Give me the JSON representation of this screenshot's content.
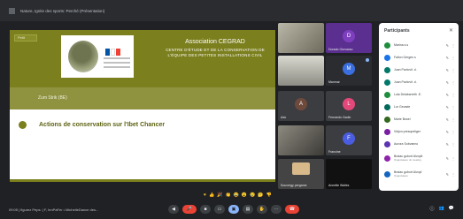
{
  "window": {
    "title": "Nature, Ignite des sports: Perché (Présentation)"
  },
  "slide": {
    "small_label": "Petit",
    "association_title": "Association CEGRAD",
    "association_subtitle": "CENTRE D'ÉTUDE ET DE LA CONSERVATION DE L'ÉQUIPE DES PETITES INSTALLATIONS CIVIL",
    "band_label": "Zum Strik (BE)",
    "action_text": "Actions de conservation sur l'Ibet Chancer"
  },
  "tiles": [
    {
      "name": "",
      "initial": "",
      "color": "#8a8a7a"
    },
    {
      "name": "Dorado Gorvasso",
      "initial": "D",
      "color": "#5b2f8f"
    },
    {
      "name": "",
      "initial": "",
      "color": "#9b9b92"
    },
    {
      "name": "Manmar",
      "initial": "M",
      "color": "#3b6fe0"
    },
    {
      "name": "Ado",
      "initial": "A",
      "color": "#6e4a3c"
    },
    {
      "name": "Fernando Gadin",
      "initial": "L",
      "color": "#e2487a"
    },
    {
      "name": "",
      "initial": "",
      "color": "#5a5a55"
    },
    {
      "name": "Francine",
      "initial": "F",
      "color": "#4a5de0"
    },
    {
      "name": "Souvergy pergame",
      "initial": "",
      "color": "#444"
    },
    {
      "name": "Annette Wailes",
      "initial": "",
      "color": "#111"
    }
  ],
  "panel": {
    "title": "Participants",
    "close": "✕",
    "participants": [
      {
        "name": "Marina s.s",
        "sub": "",
        "color": "#1e8e3e"
      },
      {
        "name": "Fallon Gerges s",
        "sub": "",
        "color": "#1a73e8"
      },
      {
        "name": "Juan Pavlovit .d.",
        "sub": "",
        "color": "#00796b"
      },
      {
        "name": "Juan Pavlovit .d.",
        "sub": "",
        "color": "#00796b"
      },
      {
        "name": "Lola Delabarreth .E.",
        "sub": "",
        "color": "#1e8e3e"
      },
      {
        "name": "Lor Gevade",
        "sub": "",
        "color": "#00695c"
      },
      {
        "name": "Marie Bosel",
        "sub": "",
        "color": "#33691e"
      },
      {
        "name": "Vidjon presopeliger",
        "sub": "",
        "color": "#7b1fa2"
      },
      {
        "name": "Aurora Sobvanno",
        "sub": "",
        "color": "#5e35b1"
      },
      {
        "name": "Braiau gubort Alvoplt",
        "sub": "Organisateur du meeting",
        "color": "#8e24aa"
      },
      {
        "name": "Braiau gubort Alvopl",
        "sub": "Organisateur",
        "color": "#1565c0"
      }
    ]
  },
  "bottom": {
    "meeting_info": "09:05 | figurez Peps: | F, hmPaFer • MichelleDance des...",
    "controls": [
      "◀",
      "🎤",
      "■",
      "▭",
      "▣",
      "▤",
      "✋",
      "⋯",
      "☎"
    ],
    "right_controls": [
      "ⓘ",
      "👥",
      "💬"
    ]
  },
  "reactions": [
    "♥",
    "👍",
    "🎉",
    "👏",
    "😂",
    "😮",
    "😢",
    "🤔",
    "👎"
  ]
}
